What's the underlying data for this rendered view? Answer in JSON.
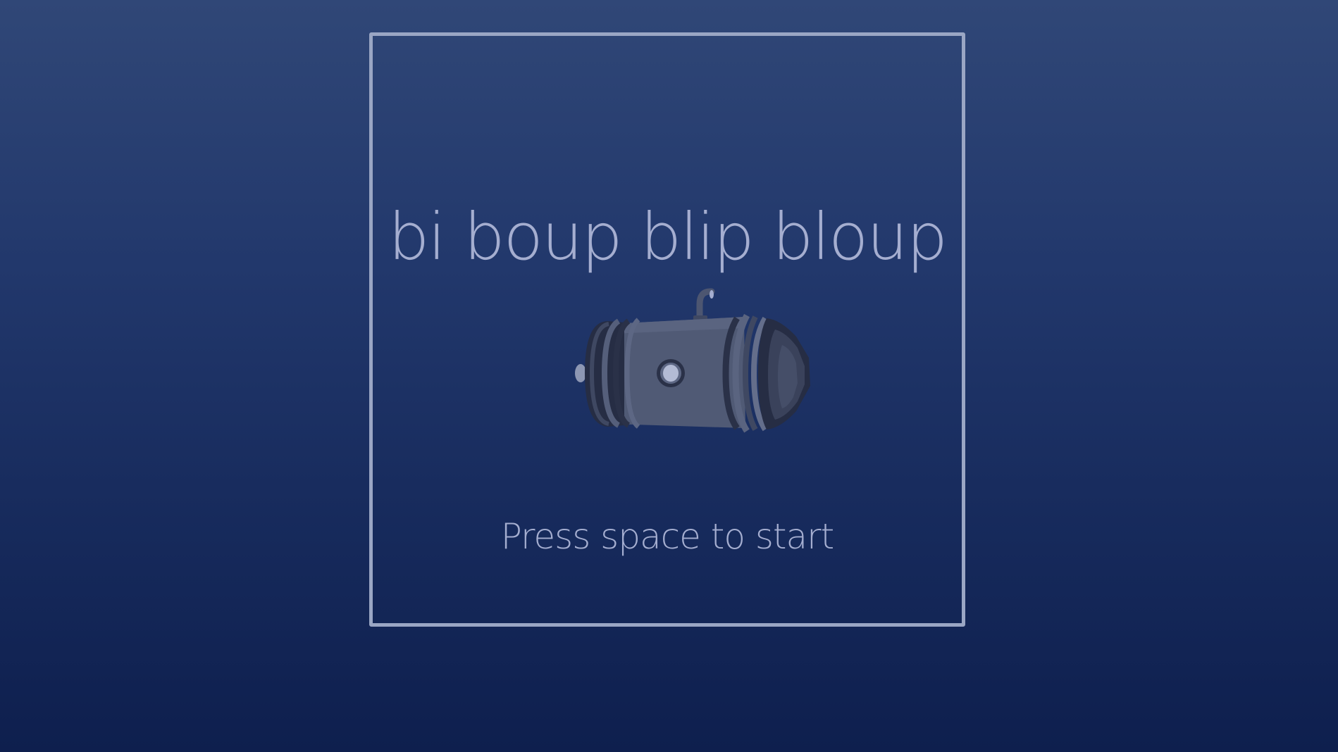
{
  "game": {
    "title": "bi boup blip bloup",
    "prompt": "Press space to start"
  },
  "colors": {
    "background_top": "#304777",
    "background_bottom": "#0e1f4e",
    "frame": "#9aa6c4",
    "text": "#a5aed0",
    "submarine_hull": "#505a75",
    "submarine_dark": "#252c42"
  },
  "icons": {
    "hero": "submarine-icon"
  }
}
